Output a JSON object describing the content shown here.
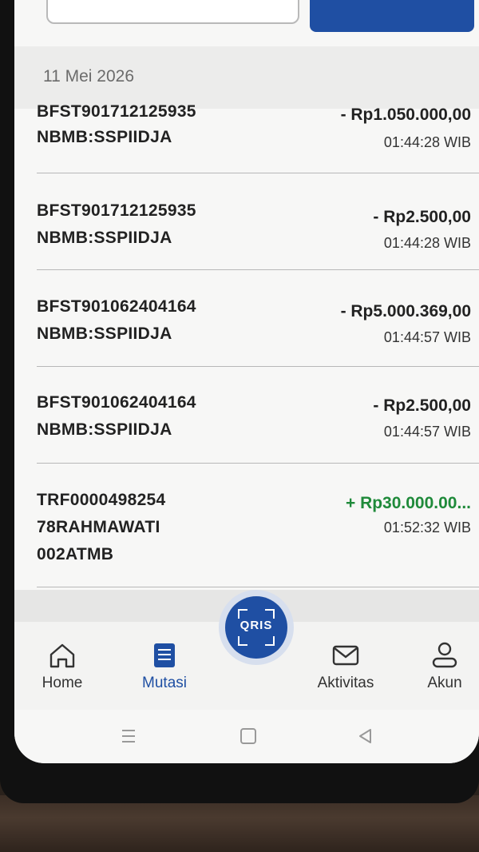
{
  "date_header": "11 Mei 2026",
  "transactions": [
    {
      "ref": "BFST901712125935",
      "desc": "NBMB:SSPIIDJA",
      "amount": "- Rp1.050.000,00",
      "time": "01:44:28 WIB",
      "type": "debit"
    },
    {
      "ref": "BFST901712125935",
      "desc": "NBMB:SSPIIDJA",
      "amount": "- Rp2.500,00",
      "time": "01:44:28 WIB",
      "type": "debit"
    },
    {
      "ref": "BFST901062404164",
      "desc": "NBMB:SSPIIDJA",
      "amount": "- Rp5.000.369,00",
      "time": "01:44:57 WIB",
      "type": "debit"
    },
    {
      "ref": "BFST901062404164",
      "desc": "NBMB:SSPIIDJA",
      "amount": "- Rp2.500,00",
      "time": "01:44:57 WIB",
      "type": "debit"
    },
    {
      "ref": "TRF0000498254",
      "desc": "78RAHMAWATI",
      "desc2": "002ATMB",
      "amount": "+ Rp30.000.00...",
      "time": "01:52:32 WIB",
      "type": "credit"
    }
  ],
  "qris": {
    "label": "QRIS"
  },
  "nav": {
    "home": "Home",
    "mutasi": "Mutasi",
    "aktivitas": "Aktivitas",
    "akun": "Akun"
  },
  "colors": {
    "brand": "#1f4fa3",
    "credit": "#1f8a3a"
  }
}
